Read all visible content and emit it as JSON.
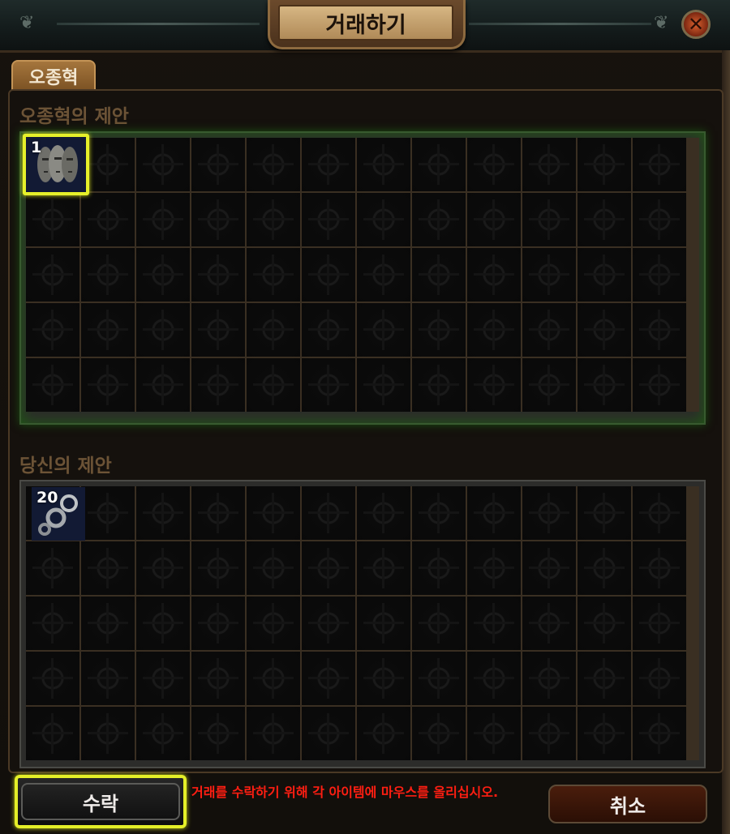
{
  "window": {
    "title": "거래하기",
    "close_icon": "close-icon"
  },
  "tab": {
    "label": "오종혁"
  },
  "their_offer": {
    "label": "오종혁의 제안",
    "grid": {
      "columns": 12,
      "rows": 5
    },
    "items": [
      {
        "name": "stone-faces-item",
        "quantity": "1",
        "highlighted": true
      }
    ]
  },
  "your_offer": {
    "label": "당신의 제안",
    "grid": {
      "columns": 12,
      "rows": 5
    },
    "items": [
      {
        "name": "chain-fragment-item",
        "quantity": "20",
        "highlighted": false
      }
    ]
  },
  "actions": {
    "accept_label": "수락",
    "cancel_label": "취소",
    "notice": "거래를 수락하기 위해 각 아이템에 마우스를 올리십시오."
  },
  "colors": {
    "highlight": "#e6f02a",
    "notice": "#ff1e12",
    "their_glow": "#1f5a14"
  }
}
